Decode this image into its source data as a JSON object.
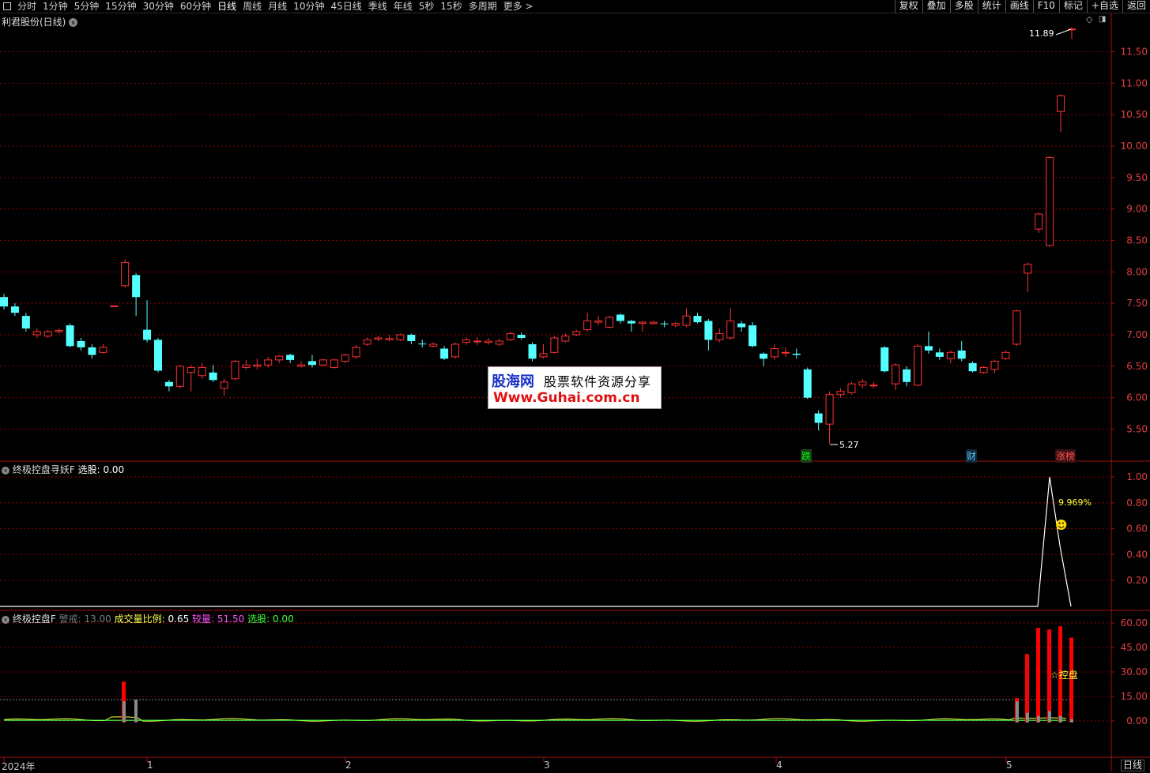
{
  "toolbar": {
    "window_icon": "window-icon",
    "periods": [
      "分时",
      "1分钟",
      "5分钟",
      "15分钟",
      "30分钟",
      "60分钟",
      "日线",
      "周线",
      "月线",
      "10分钟",
      "45日线",
      "季线",
      "年线",
      "5秒",
      "15秒",
      "多周期",
      "更多 >"
    ],
    "active_period": "日线",
    "right_buttons": [
      "复权",
      "叠加",
      "多股",
      "统计",
      "画线",
      "F10",
      "标记",
      "+自选",
      "返回"
    ]
  },
  "colors": {
    "up": "#ff3232",
    "down": "#54ffff",
    "grid": "#8b0000",
    "axis": "#a01010",
    "watermark_blue": "#1a33c9",
    "watermark_red": "#e21010"
  },
  "main_panel": {
    "title": "利君股份(日线)",
    "high_label": "11.89",
    "low_label": "5.27",
    "markers": [
      "跌",
      "财",
      "涨榜"
    ]
  },
  "panel2": {
    "title": "终极控盘寻妖F",
    "select_label": "选股:",
    "select_value": "0.00",
    "pct_label": "9.969%"
  },
  "panel3": {
    "title": "终极控盘F",
    "warn_label": "警戒:",
    "warn_value": "13.00",
    "ratio_label": "成交量比例:",
    "ratio_value": "0.65",
    "volume_label": "较量:",
    "volume_value": "51.50",
    "select_label": "选股:",
    "select_value": "0.00",
    "control_label": "☆控盘"
  },
  "x_axis": {
    "labels": [
      "2024年",
      "1",
      "2",
      "3",
      "4",
      "5"
    ],
    "period_button": "日线"
  },
  "watermark": {
    "line1_brand": "股海网",
    "line1_text": "股票软件资源分享",
    "line2": "Www.Guhai.com.cn"
  },
  "chart_data": [
    {
      "type": "candlestick",
      "title": "利君股份(日线)",
      "ylim": [
        5.2,
        11.95
      ],
      "y_ticks": [
        5.5,
        6.0,
        6.5,
        7.0,
        7.5,
        8.0,
        8.5,
        9.0,
        9.5,
        10.0,
        10.5,
        11.0,
        11.5
      ],
      "candles": [
        [
          7.6,
          7.45,
          7.65,
          7.4
        ],
        [
          7.45,
          7.35,
          7.5,
          7.3
        ],
        [
          7.3,
          7.1,
          7.35,
          7.05
        ],
        [
          7.0,
          7.05,
          7.1,
          6.95
        ],
        [
          6.98,
          7.05,
          7.08,
          6.95
        ],
        [
          7.05,
          7.07,
          7.1,
          7.02
        ],
        [
          7.15,
          6.82,
          7.18,
          6.8
        ],
        [
          6.9,
          6.8,
          6.95,
          6.75
        ],
        [
          6.8,
          6.68,
          6.85,
          6.62
        ],
        [
          6.72,
          6.8,
          6.85,
          6.7
        ],
        [
          7.45,
          7.46,
          7.47,
          7.44
        ],
        [
          7.78,
          8.15,
          8.2,
          7.75
        ],
        [
          7.95,
          7.6,
          7.98,
          7.3
        ],
        [
          7.08,
          6.92,
          7.55,
          6.88
        ],
        [
          6.92,
          6.43,
          6.95,
          6.4
        ],
        [
          6.25,
          6.18,
          6.28,
          6.1
        ],
        [
          6.18,
          6.5,
          6.52,
          6.15
        ],
        [
          6.4,
          6.48,
          6.52,
          6.1
        ],
        [
          6.35,
          6.48,
          6.55,
          6.3
        ],
        [
          6.4,
          6.28,
          6.52,
          6.25
        ],
        [
          6.15,
          6.25,
          6.3,
          6.03
        ],
        [
          6.3,
          6.58,
          6.6,
          6.28
        ],
        [
          6.48,
          6.52,
          6.6,
          6.45
        ],
        [
          6.5,
          6.52,
          6.62,
          6.45
        ],
        [
          6.52,
          6.6,
          6.65,
          6.48
        ],
        [
          6.6,
          6.66,
          6.68,
          6.55
        ],
        [
          6.68,
          6.6,
          6.7,
          6.55
        ],
        [
          6.5,
          6.52,
          6.58,
          6.48
        ],
        [
          6.58,
          6.52,
          6.68,
          6.48
        ],
        [
          6.52,
          6.6,
          6.62,
          6.5
        ],
        [
          6.48,
          6.6,
          6.62,
          6.46
        ],
        [
          6.58,
          6.68,
          6.7,
          6.55
        ],
        [
          6.65,
          6.8,
          6.84,
          6.62
        ],
        [
          6.85,
          6.92,
          6.96,
          6.82
        ],
        [
          6.93,
          6.95,
          6.98,
          6.9
        ],
        [
          6.92,
          6.94,
          7.0,
          6.9
        ],
        [
          6.92,
          7.0,
          7.02,
          6.9
        ],
        [
          7.0,
          6.9,
          7.02,
          6.85
        ],
        [
          6.86,
          6.85,
          6.92,
          6.8
        ],
        [
          6.82,
          6.85,
          6.88,
          6.8
        ],
        [
          6.78,
          6.62,
          6.82,
          6.6
        ],
        [
          6.65,
          6.85,
          6.88,
          6.62
        ],
        [
          6.88,
          6.92,
          6.96,
          6.84
        ],
        [
          6.89,
          6.9,
          6.96,
          6.84
        ],
        [
          6.88,
          6.9,
          6.95,
          6.84
        ],
        [
          6.85,
          6.9,
          6.94,
          6.82
        ],
        [
          6.92,
          7.02,
          7.05,
          6.9
        ],
        [
          7.0,
          6.95,
          7.04,
          6.92
        ],
        [
          6.85,
          6.62,
          6.88,
          6.58
        ],
        [
          6.65,
          6.7,
          6.85,
          6.62
        ],
        [
          6.72,
          6.95,
          6.98,
          6.7
        ],
        [
          6.9,
          6.98,
          7.02,
          6.88
        ],
        [
          7.0,
          7.05,
          7.08,
          6.98
        ],
        [
          7.08,
          7.22,
          7.35,
          7.05
        ],
        [
          7.2,
          7.22,
          7.3,
          7.15
        ],
        [
          7.12,
          7.28,
          7.3,
          7.1
        ],
        [
          7.32,
          7.22,
          7.34,
          7.18
        ],
        [
          7.22,
          7.18,
          7.24,
          7.05
        ],
        [
          7.18,
          7.2,
          7.22,
          7.05
        ],
        [
          7.18,
          7.2,
          7.22,
          7.16
        ],
        [
          7.18,
          7.17,
          7.22,
          7.12
        ],
        [
          7.15,
          7.18,
          7.2,
          7.12
        ],
        [
          7.15,
          7.3,
          7.42,
          7.12
        ],
        [
          7.3,
          7.2,
          7.35,
          7.18
        ],
        [
          7.22,
          6.92,
          7.25,
          6.75
        ],
        [
          6.92,
          7.02,
          7.1,
          6.88
        ],
        [
          6.95,
          7.22,
          7.42,
          6.92
        ],
        [
          7.18,
          7.12,
          7.22,
          7.05
        ],
        [
          7.15,
          6.82,
          7.2,
          6.8
        ],
        [
          6.7,
          6.62,
          6.72,
          6.5
        ],
        [
          6.65,
          6.78,
          6.85,
          6.6
        ],
        [
          6.72,
          6.72,
          6.8,
          6.65
        ],
        [
          6.7,
          6.68,
          6.78,
          6.62
        ],
        [
          6.45,
          6.0,
          6.48,
          5.98
        ],
        [
          5.75,
          5.6,
          5.8,
          5.48
        ],
        [
          5.58,
          6.05,
          6.1,
          5.27
        ],
        [
          6.05,
          6.1,
          6.15,
          6.0
        ],
        [
          6.08,
          6.22,
          6.25,
          6.05
        ],
        [
          6.2,
          6.25,
          6.3,
          6.15
        ],
        [
          6.2,
          6.2,
          6.25,
          6.15
        ],
        [
          6.8,
          6.42,
          6.82,
          6.4
        ],
        [
          6.22,
          6.52,
          6.55,
          6.12
        ],
        [
          6.45,
          6.25,
          6.5,
          6.18
        ],
        [
          6.2,
          6.82,
          6.85,
          6.18
        ],
        [
          6.82,
          6.75,
          7.05,
          6.7
        ],
        [
          6.72,
          6.65,
          6.78,
          6.6
        ],
        [
          6.62,
          6.72,
          6.75,
          6.55
        ],
        [
          6.75,
          6.62,
          6.9,
          6.58
        ],
        [
          6.55,
          6.42,
          6.58,
          6.4
        ],
        [
          6.4,
          6.48,
          6.5,
          6.38
        ],
        [
          6.45,
          6.58,
          6.6,
          6.4
        ],
        [
          6.62,
          6.72,
          6.75,
          6.6
        ],
        [
          6.85,
          7.38,
          7.4,
          6.82
        ],
        [
          7.98,
          8.12,
          8.15,
          7.68
        ],
        [
          8.68,
          8.92,
          8.94,
          8.62
        ],
        [
          8.42,
          9.82,
          9.84,
          8.4
        ],
        [
          10.55,
          10.8,
          10.82,
          10.22
        ],
        [
          11.85,
          11.86,
          11.89,
          11.7
        ]
      ]
    },
    {
      "type": "line",
      "title": "终极控盘寻妖F",
      "ylim": [
        0,
        1.04
      ],
      "y_ticks": [
        0.2,
        0.4,
        0.6,
        0.8,
        1.0
      ],
      "series": [
        {
          "name": "选股",
          "points": [
            [
              0,
              0
            ],
            [
              1313,
              0
            ],
            [
              1328,
              1.0
            ],
            [
              1341,
              0.47
            ],
            [
              1355,
              0
            ]
          ]
        }
      ],
      "bar": {
        "x_index": 1342,
        "value": 0.5
      }
    },
    {
      "type": "bar",
      "title": "终极控盘F",
      "ylim": [
        -6,
        64
      ],
      "y_ticks": [
        0.0,
        15.0,
        30.0,
        45.0,
        60.0
      ],
      "warning_line": 13.0,
      "red_bars": [
        [
          157,
          24
        ],
        [
          1287,
          14
        ],
        [
          1300,
          41
        ],
        [
          1314,
          57
        ],
        [
          1328,
          56
        ],
        [
          1342,
          58
        ],
        [
          1356,
          51
        ]
      ],
      "gray_bars": [
        [
          157,
          12
        ],
        [
          172,
          13
        ],
        [
          1287,
          12
        ],
        [
          1300,
          5
        ],
        [
          1314,
          3
        ],
        [
          1328,
          6
        ],
        [
          1342,
          3
        ],
        [
          1356,
          1
        ]
      ]
    }
  ]
}
